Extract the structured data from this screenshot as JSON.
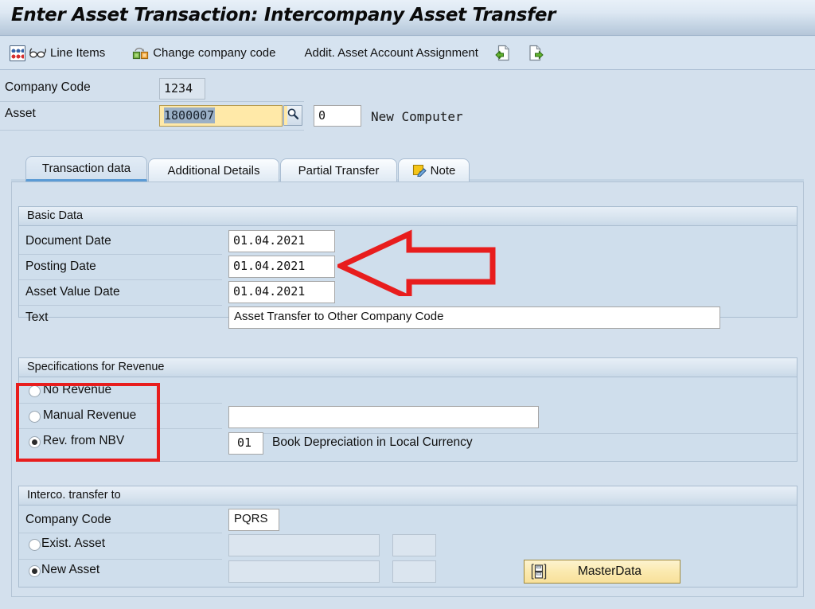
{
  "window": {
    "title": "Enter Asset Transaction: Intercompany Asset Transfer"
  },
  "toolbar": {
    "items": [
      {
        "label": "Line Items",
        "icons": [
          "abacus-icon",
          "glasses-icon"
        ]
      },
      {
        "label": "Change company code",
        "icons": [
          "change-company-code-icon"
        ]
      },
      {
        "label": "Addit. Asset Account Assignment",
        "icons": []
      }
    ],
    "trailing_icons": [
      "document-import-icon",
      "document-export-icon"
    ]
  },
  "header": {
    "company_code": {
      "label": "Company Code",
      "value": "1234"
    },
    "asset": {
      "label": "Asset",
      "value": "1800007",
      "selected": true,
      "search_help_icon": "magnifier-icon",
      "subnumber": "0",
      "description": "New Computer"
    }
  },
  "tabs": [
    {
      "label": "Transaction data",
      "active": true,
      "icon": ""
    },
    {
      "label": "Additional Details",
      "active": false,
      "icon": ""
    },
    {
      "label": "Partial Transfer",
      "active": false,
      "icon": ""
    },
    {
      "label": "Note",
      "active": false,
      "icon": "note-pencil-icon"
    }
  ],
  "basic_data": {
    "title": "Basic Data",
    "document_date": {
      "label": "Document Date",
      "value": "01.04.2021"
    },
    "posting_date": {
      "label": "Posting Date",
      "value": "01.04.2021"
    },
    "asset_value_date": {
      "label": "Asset Value Date",
      "value": "01.04.2021"
    },
    "text": {
      "label": "Text",
      "value": "Asset Transfer to Other Company Code"
    }
  },
  "revenue": {
    "title": "Specifications for Revenue",
    "options": [
      {
        "label": "No Revenue",
        "selected": false
      },
      {
        "label": "Manual Revenue",
        "selected": false
      },
      {
        "label": "Rev. from NBV",
        "selected": true
      }
    ],
    "manual_revenue_value": "",
    "nbv_area_key": "01",
    "nbv_area_text": "Book Depreciation in Local Currency"
  },
  "interco": {
    "title": "Interco. transfer to",
    "company_code": {
      "label": "Company Code",
      "value": "PQRS"
    },
    "exist_asset": {
      "label": "Exist. Asset",
      "selected": false,
      "value": "",
      "subnumber": ""
    },
    "new_asset": {
      "label": "New Asset",
      "selected": true,
      "value": "",
      "subnumber": ""
    },
    "masterdata_button": {
      "label": "MasterData",
      "icon": "disk-icon"
    }
  },
  "annotations": {
    "arrow_color": "#e81d1d",
    "box_color": "#e81d1d",
    "arrow_points_to": "Posting Date",
    "box_around": "Specifications for Revenue radio group"
  },
  "colors": {
    "window_background": "#d3e0ed",
    "titlebar_gradient_top": "#e8f0f8",
    "titlebar_gradient_bottom": "#b5c6d9",
    "toolbar_background": "#d6e3f0",
    "focus_field_yellow": "#ffe9a8",
    "selection_blue": "#9bb0c6",
    "active_tab_underline": "#5b9bd5",
    "masterdata_button_yellow": "#fbeab0",
    "annotation_red": "#e81d1d"
  }
}
